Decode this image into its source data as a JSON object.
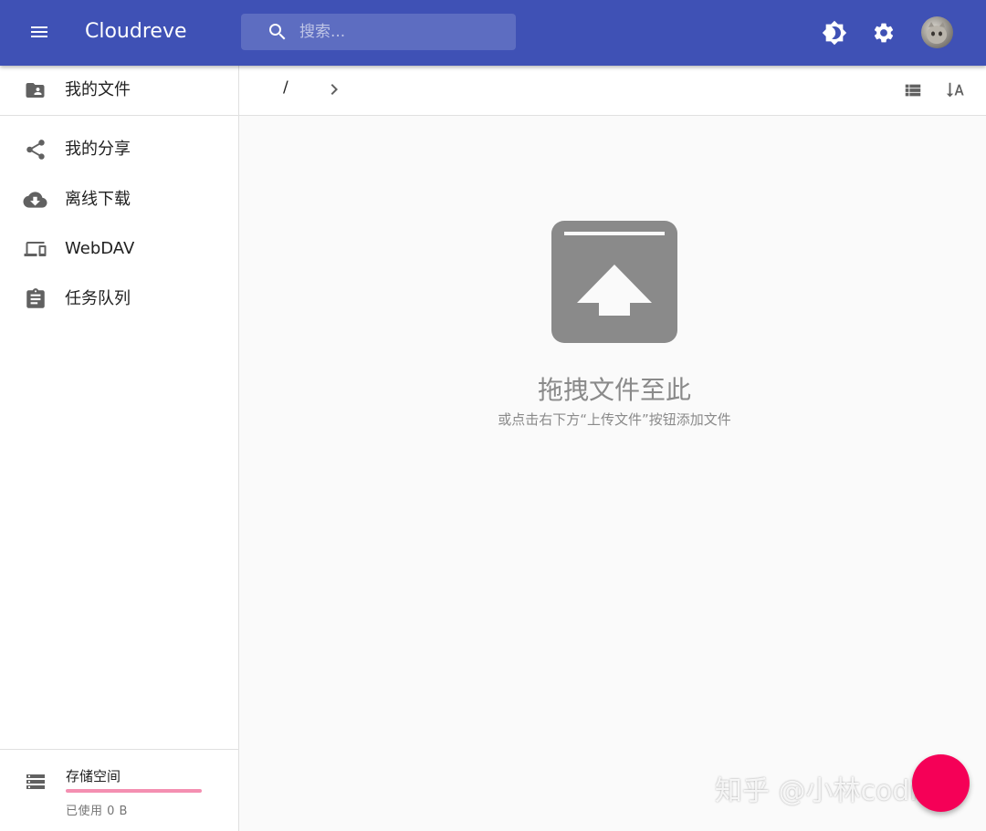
{
  "app": {
    "title": "Cloudreve"
  },
  "search": {
    "placeholder": "搜索..."
  },
  "sidebar": {
    "items": [
      {
        "label": "我的文件",
        "icon": "folder-account-icon"
      },
      {
        "label": "我的分享",
        "icon": "share-icon"
      },
      {
        "label": "离线下载",
        "icon": "cloud-download-icon"
      },
      {
        "label": "WebDAV",
        "icon": "devices-icon"
      },
      {
        "label": "任务队列",
        "icon": "clipboard-list-icon"
      }
    ],
    "storage": {
      "title": "存储空间",
      "used_text": "已使用 0 B",
      "used_fraction": 0
    }
  },
  "breadcrumb": {
    "root": "/"
  },
  "empty_state": {
    "title": "拖拽文件至此",
    "subtitle": "或点击右下方“上传文件”按钮添加文件"
  },
  "watermark": "知乎 @小林coding",
  "colors": {
    "primary": "#3f51b5",
    "accent": "#f50057",
    "icon_gray": "#616161",
    "empty_gray": "#8a8a8a"
  }
}
